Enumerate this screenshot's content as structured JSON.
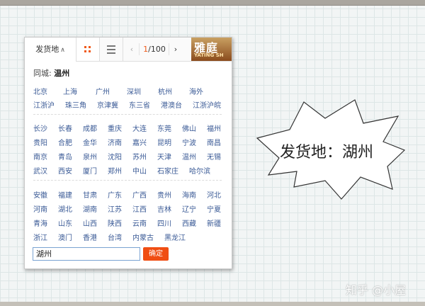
{
  "toolbar": {
    "origin_tab_label": "发货地",
    "page_current": "1",
    "page_total": "/100",
    "ad_cn": "雅庭",
    "ad_en": "YATING SH"
  },
  "same_city": {
    "label": "同城:",
    "value": "温州"
  },
  "groups": [
    [
      [
        "北京",
        "上海",
        "广州",
        "深圳",
        "杭州",
        "海外"
      ],
      [
        "江浙沪",
        "珠三角",
        "京津冀",
        "东三省",
        "港澳台",
        "江浙沪皖"
      ]
    ],
    [
      [
        "长沙",
        "长春",
        "成都",
        "重庆",
        "大连",
        "东莞",
        "佛山",
        "福州"
      ],
      [
        "贵阳",
        "合肥",
        "金华",
        "济南",
        "嘉兴",
        "昆明",
        "宁波",
        "南昌"
      ],
      [
        "南京",
        "青岛",
        "泉州",
        "沈阳",
        "苏州",
        "天津",
        "温州",
        "无锡"
      ],
      [
        "武汉",
        "西安",
        "厦门",
        "郑州",
        "中山",
        "石家庄",
        "哈尔滨"
      ]
    ],
    [
      [
        "安徽",
        "福建",
        "甘肃",
        "广东",
        "广西",
        "贵州",
        "海南",
        "河北"
      ],
      [
        "河南",
        "湖北",
        "湖南",
        "江苏",
        "江西",
        "吉林",
        "辽宁",
        "宁夏"
      ],
      [
        "青海",
        "山东",
        "山西",
        "陕西",
        "云南",
        "四川",
        "西藏",
        "新疆"
      ],
      [
        "浙江",
        "澳门",
        "香港",
        "台湾",
        "内蒙古",
        "黑龙江"
      ]
    ]
  ],
  "input": {
    "value": "湖州"
  },
  "confirm_label": "确定",
  "callout_text": "发货地：湖州",
  "watermark": "知乎 @小屋",
  "colors": {
    "accent": "#f04e13",
    "link": "#3a5a96"
  }
}
